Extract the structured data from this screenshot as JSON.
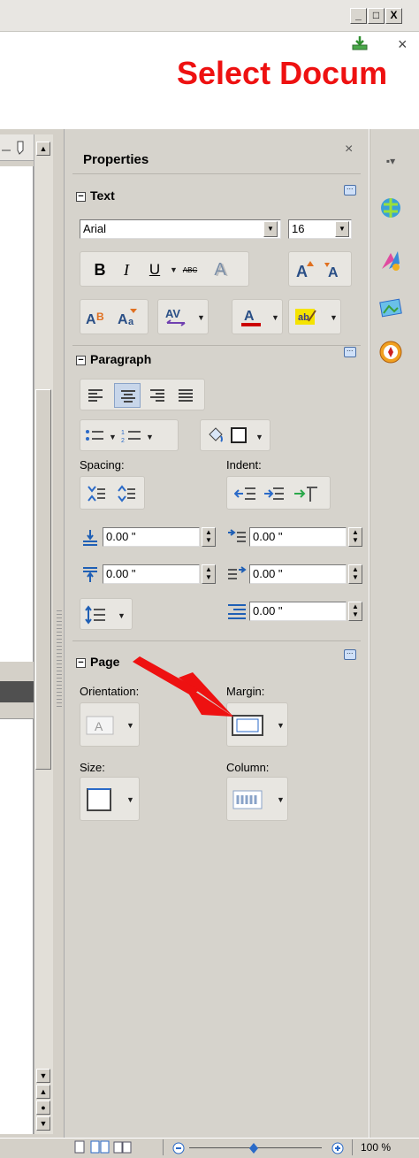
{
  "window": {
    "title_text": "Select Docum",
    "minimize_label": "_",
    "maximize_label": "□",
    "close_label": "X",
    "doc_close_label": "×"
  },
  "sidebar": {
    "title": "Properties",
    "close_label": "×",
    "text_panel": {
      "title": "Text",
      "font_name": "Arial",
      "font_size": "16",
      "bold": "B",
      "italic": "I",
      "underline": "U",
      "strikethrough": "ABC",
      "shadow": "A"
    },
    "paragraph_panel": {
      "title": "Paragraph",
      "spacing_label": "Spacing:",
      "indent_label": "Indent:",
      "above_spacing": "0.00 \"",
      "below_spacing": "0.00 \"",
      "before_indent": "0.00 \"",
      "after_indent": "0.00 \"",
      "first_line_indent": "0.00 \""
    },
    "page_panel": {
      "title": "Page",
      "orientation_label": "Orientation:",
      "margin_label": "Margin:",
      "size_label": "Size:",
      "column_label": "Column:"
    }
  },
  "statusbar": {
    "zoom_level": "100 %"
  },
  "colors": {
    "title_red": "#ee1111",
    "arrow_red": "#ee1111",
    "font_color_bar": "#cc0000",
    "highlight_yellow": "#f5e300"
  },
  "icons": [
    "navigator-icon",
    "gallery-icon",
    "styles-icon",
    "functions-icon",
    "compass-icon",
    "sidebar-menu-icon"
  ]
}
